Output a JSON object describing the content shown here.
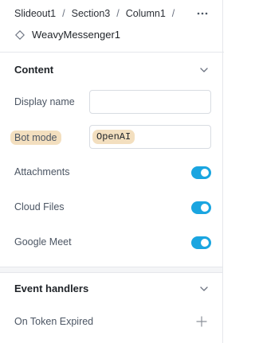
{
  "breadcrumb": {
    "items": [
      "Slideout1",
      "Section3",
      "Column1"
    ],
    "separator": "/"
  },
  "header": {
    "component_name": "WeavyMessenger1",
    "component_icon": "diamond-icon",
    "more_icon": "more-horizontal-icon"
  },
  "content_section": {
    "title": "Content",
    "expanded": true,
    "fields": {
      "display_name": {
        "label": "Display name",
        "value": ""
      },
      "bot_mode": {
        "label": "Bot mode",
        "value": "OpenAI"
      },
      "attachments": {
        "label": "Attachments",
        "enabled": true
      },
      "cloud_files": {
        "label": "Cloud Files",
        "enabled": true
      },
      "google_meet": {
        "label": "Google Meet",
        "enabled": true
      }
    }
  },
  "event_handlers_section": {
    "title": "Event handlers",
    "expanded": true,
    "items": [
      {
        "label": "On Token Expired",
        "action_icon": "plus-icon"
      }
    ]
  },
  "colors": {
    "toggle_on": "#1aa5e0",
    "highlight": "#f3dfbf",
    "border": "#d8dce2"
  }
}
